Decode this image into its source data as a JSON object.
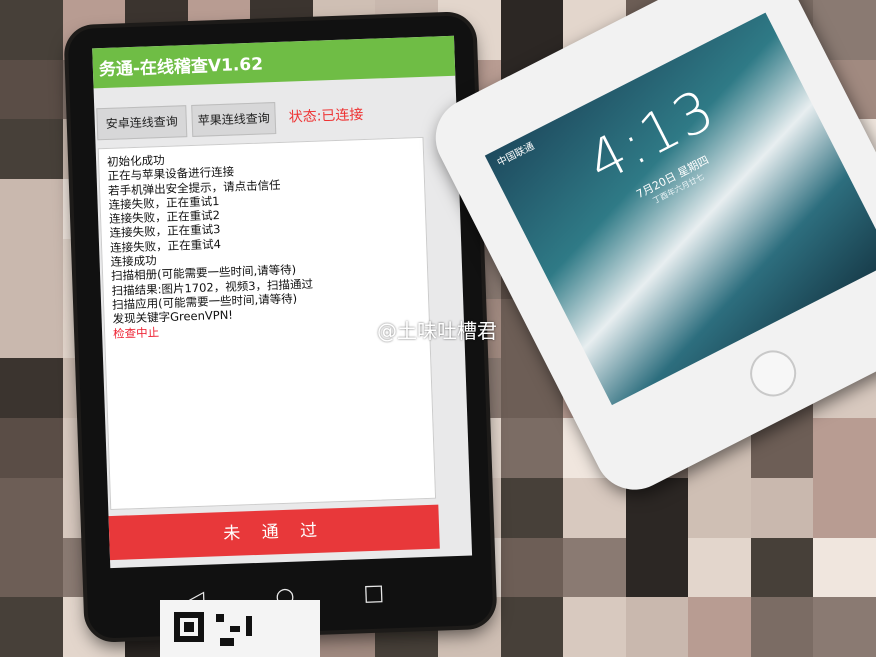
{
  "android_app": {
    "title": "务通-在线稽查V1.62",
    "buttons": {
      "android_connect": "安卓连线查询",
      "apple_connect": "苹果连线查询"
    },
    "status": "状态:已连接",
    "log_lines": [
      "初始化成功",
      "正在与苹果设备进行连接",
      "若手机弹出安全提示，请点击信任",
      "连接失败，正在重试1",
      "连接失败，正在重试2",
      "连接失败，正在重试3",
      "连接失败，正在重试4",
      "连接成功",
      "扫描相册(可能需要一些时间,请等待)",
      "扫描结果:图片1702，视频3，扫描通过",
      "扫描应用(可能需要一些时间,请等待)",
      "发现关键字GreenVPN!"
    ],
    "error_line": "检查中止",
    "result_button": "未 通 过",
    "accent_green": "#6fbd45",
    "accent_red": "#e8383a"
  },
  "iphone": {
    "carrier": "中国联通",
    "time": "4:13",
    "date": "7月20日 星期四",
    "lunar_date": "丁酉年六月廿七"
  },
  "watermark": {
    "text": "@土味吐槽君",
    "icon": "weibo-icon"
  }
}
